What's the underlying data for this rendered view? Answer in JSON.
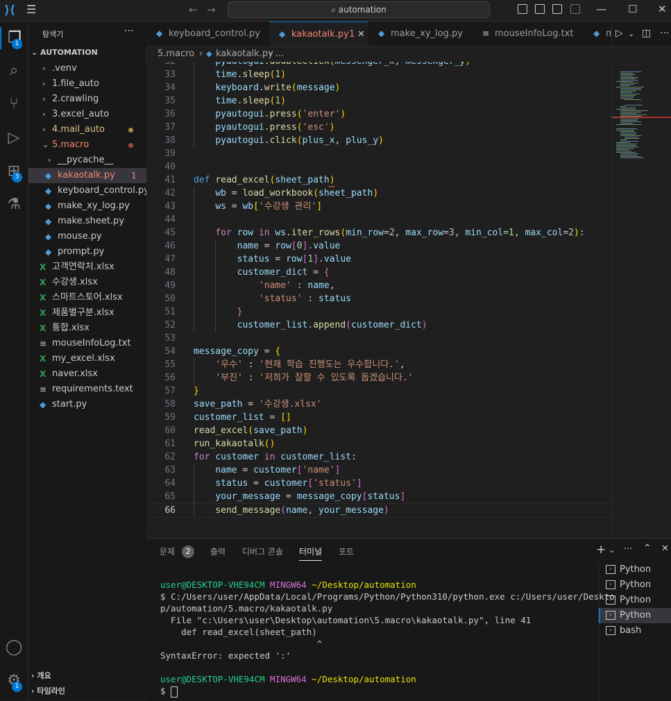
{
  "titlebar": {
    "search_text": "automation",
    "back": "←",
    "forward": "→"
  },
  "activity": {
    "explorer_badge": "1",
    "extensions_badge": "3",
    "settings_badge": "1"
  },
  "sidebar": {
    "title": "탐색기",
    "more": "···",
    "root": "AUTOMATION",
    "items": [
      {
        "label": ".venv",
        "type": "folder",
        "depth": 1,
        "open": false
      },
      {
        "label": "1.file_auto",
        "type": "folder",
        "depth": 1,
        "open": false
      },
      {
        "label": "2.crawling",
        "type": "folder",
        "depth": 1,
        "open": false
      },
      {
        "label": "3.excel_auto",
        "type": "folder",
        "depth": 1,
        "open": false
      },
      {
        "label": "4.mail_auto",
        "type": "folder",
        "depth": 1,
        "open": false,
        "modified": true
      },
      {
        "label": "5.macro",
        "type": "folder",
        "depth": 1,
        "open": true,
        "error": true
      },
      {
        "label": "__pycache__",
        "type": "folder",
        "depth": 2,
        "open": false
      },
      {
        "label": "kakaotalk.py",
        "type": "py",
        "depth": 2,
        "selected": true,
        "error_count": "1"
      },
      {
        "label": "keyboard_control.py",
        "type": "py",
        "depth": 2
      },
      {
        "label": "make_xy_log.py",
        "type": "py",
        "depth": 2
      },
      {
        "label": "make.sheet.py",
        "type": "py",
        "depth": 2
      },
      {
        "label": "mouse.py",
        "type": "py",
        "depth": 2
      },
      {
        "label": "prompt.py",
        "type": "py",
        "depth": 2
      },
      {
        "label": "고객연락처.xlsx",
        "type": "xlsx",
        "depth": 1
      },
      {
        "label": "수강생.xlsx",
        "type": "xlsx",
        "depth": 1
      },
      {
        "label": "스마트스토어.xlsx",
        "type": "xlsx",
        "depth": 1
      },
      {
        "label": "제품별구분.xlsx",
        "type": "xlsx",
        "depth": 1
      },
      {
        "label": "통합.xlsx",
        "type": "xlsx",
        "depth": 1
      },
      {
        "label": "mouseInfoLog.txt",
        "type": "txt",
        "depth": 1
      },
      {
        "label": "my_excel.xlsx",
        "type": "xlsx",
        "depth": 1
      },
      {
        "label": "naver.xlsx",
        "type": "xlsx",
        "depth": 1
      },
      {
        "label": "requirements.text",
        "type": "txt",
        "depth": 1
      },
      {
        "label": "start.py",
        "type": "py",
        "depth": 1
      }
    ],
    "outline": "개요",
    "timeline": "타임라인"
  },
  "tabs": [
    {
      "label": "keyboard_control.py",
      "icon": "python-icon"
    },
    {
      "label": "kakaotalk.py",
      "icon": "python-icon",
      "active": true,
      "suffix": "1"
    },
    {
      "label": "make_xy_log.py",
      "icon": "python-icon"
    },
    {
      "label": "mouseInfoLog.txt",
      "icon": "text-icon"
    },
    {
      "label": "m",
      "icon": "python-icon"
    }
  ],
  "breadcrumb": {
    "folder": "5.macro",
    "file": "kakaotalk.py",
    "rest": "..."
  },
  "editor": {
    "first_line": 32,
    "current_line": 66,
    "lines": [
      {
        "n": "32",
        "html": "    <span class='vr'>pyautogui</span>.<span class='fn'>doubleClick</span><span class='pn'>(</span><span class='vr'>messenger_x</span>, <span class='vr'>messenger_y</span><span class='pn'>)</span>"
      },
      {
        "n": "33",
        "html": "    <span class='vr'>time</span>.<span class='fn'>sleep</span><span class='pn'>(</span><span class='nm'>1</span><span class='pn'>)</span>"
      },
      {
        "n": "34",
        "html": "    <span class='vr'>keyboard</span>.<span class='fn'>write</span><span class='pn'>(</span><span class='vr'>message</span><span class='pn'>)</span>"
      },
      {
        "n": "35",
        "html": "    <span class='vr'>time</span>.<span class='fn'>sleep</span><span class='pn'>(</span><span class='nm'>1</span><span class='pn'>)</span>"
      },
      {
        "n": "36",
        "html": "    <span class='vr'>pyautogui</span>.<span class='fn'>press</span><span class='pn'>(</span><span class='st'>'enter'</span><span class='pn'>)</span>"
      },
      {
        "n": "37",
        "html": "    <span class='vr'>pyautogui</span>.<span class='fn'>press</span><span class='pn'>(</span><span class='st'>'esc'</span><span class='pn'>)</span>"
      },
      {
        "n": "38",
        "html": "    <span class='vr'>pyautogui</span>.<span class='fn'>click</span><span class='pn'>(</span><span class='vr'>plus_x</span>, <span class='vr'>plus_y</span><span class='pn'>)</span>"
      },
      {
        "n": "39",
        "html": ""
      },
      {
        "n": "40",
        "html": ""
      },
      {
        "n": "41",
        "html": "<span class='kw'>def</span> <span class='fn'>read_excel</span><span class='pn'>(</span><span class='vr'>sheet_path</span><span class='pn'>)</span>"
      },
      {
        "n": "42",
        "html": "    <span class='vr'>wb</span> = <span class='fn'>load_workbook</span><span class='pn'>(</span><span class='vr'>sheet_path</span><span class='pn'>)</span>"
      },
      {
        "n": "43",
        "html": "    <span class='vr'>ws</span> = <span class='vr'>wb</span><span class='pn'>[</span><span class='st'>'수강생 관리'</span><span class='pn'>]</span>"
      },
      {
        "n": "44",
        "html": ""
      },
      {
        "n": "45",
        "html": "    <span class='kw2'>for</span> <span class='vr'>row</span> <span class='kw2'>in</span> <span class='vr'>ws</span>.<span class='fn'>iter_rows</span><span class='pn'>(</span><span class='vr'>min_row</span>=<span class='nm'>2</span>, <span class='vr'>max_row</span>=<span class='nm'>3</span>, <span class='vr'>min_col</span>=<span class='nm'>1</span>, <span class='vr'>max_col</span>=<span class='nm'>2</span><span class='pn'>)</span>:"
      },
      {
        "n": "46",
        "html": "        <span class='vr'>name</span> = <span class='vr'>row</span><span class='pn2'>[</span><span class='nm'>0</span><span class='pn2'>]</span>.<span class='vr'>value</span>"
      },
      {
        "n": "47",
        "html": "        <span class='vr'>status</span> = <span class='vr'>row</span><span class='pn2'>[</span><span class='nm'>1</span><span class='pn2'>]</span>.<span class='vr'>value</span>"
      },
      {
        "n": "48",
        "html": "        <span class='vr'>customer_dict</span> = <span class='pn2'>{</span>"
      },
      {
        "n": "49",
        "html": "            <span class='st'>'name'</span> : <span class='vr'>name</span>,"
      },
      {
        "n": "50",
        "html": "            <span class='st'>'status'</span> : <span class='vr'>status</span>"
      },
      {
        "n": "51",
        "html": "        <span class='pn2'>}</span>"
      },
      {
        "n": "52",
        "html": "        <span class='vr'>customer_list</span>.<span class='fn'>append</span><span class='pn2'>(</span><span class='vr'>customer_dict</span><span class='pn2'>)</span>"
      },
      {
        "n": "53",
        "html": ""
      },
      {
        "n": "54",
        "html": "<span class='vr'>message_copy</span> = <span class='pn'>{</span>"
      },
      {
        "n": "55",
        "html": "    <span class='st'>'우수'</span> : <span class='st'>'현재 학습 진행도는 우수합니다.'</span>,"
      },
      {
        "n": "56",
        "html": "    <span class='st'>'부진'</span> : <span class='st'>'저희가 잘할 수 있도록 돕겠습니다.'</span>"
      },
      {
        "n": "57",
        "html": "<span class='pn'>}</span>"
      },
      {
        "n": "58",
        "html": "<span class='vr'>save_path</span> = <span class='st'>'수강생.xlsx'</span>"
      },
      {
        "n": "59",
        "html": "<span class='vr'>customer_list</span> = <span class='pn'>[]</span>"
      },
      {
        "n": "60",
        "html": "<span class='fn'>read_excel</span><span class='pn'>(</span><span class='vr'>save_path</span><span class='pn'>)</span>"
      },
      {
        "n": "61",
        "html": "<span class='fn'>run_kakaotalk</span><span class='pn'>()</span>"
      },
      {
        "n": "62",
        "html": "<span class='kw2'>for</span> <span class='vr'>customer</span> <span class='kw2'>in</span> <span class='vr'>customer_list</span>:"
      },
      {
        "n": "63",
        "html": "    <span class='vr'>name</span> = <span class='vr'>customer</span><span class='pn2'>[</span><span class='st'>'name'</span><span class='pn2'>]</span>"
      },
      {
        "n": "64",
        "html": "    <span class='vr'>status</span> = <span class='vr'>customer</span><span class='pn2'>[</span><span class='st'>'status'</span><span class='pn2'>]</span>"
      },
      {
        "n": "65",
        "html": "    <span class='vr'>your_message</span> = <span class='vr'>message_copy</span><span class='pn2'>[</span><span class='vr'>status</span><span class='pn2'>]</span>"
      },
      {
        "n": "66",
        "html": "    <span class='fn'>send_message</span><span class='pn2'>(</span><span class='vr'>name</span>, <span class='vr'>your_message</span><span class='pn2'>)</span>"
      }
    ]
  },
  "panel": {
    "tabs": [
      {
        "label": "문제",
        "badge": "2"
      },
      {
        "label": "출력"
      },
      {
        "label": "디버그 콘솔"
      },
      {
        "label": "터미널",
        "active": true
      },
      {
        "label": "포트"
      }
    ],
    "add": "+",
    "more": "···",
    "terminal_lines": [
      {
        "parts": [
          {
            "t": "user@DESKTOP-VHE94CM",
            "c": "t-green"
          },
          {
            "t": " "
          },
          {
            "t": "MINGW64",
            "c": "t-mag"
          },
          {
            "t": " "
          },
          {
            "t": "~/Desktop/automation",
            "c": "t-yel"
          }
        ]
      },
      {
        "parts": [
          {
            "t": "$ C:/Users/user/AppData/Local/Programs/Python/Python310/python.exe c:/Users/user/Deskto"
          }
        ]
      },
      {
        "parts": [
          {
            "t": "p/automation/5.macro/kakaotalk.py"
          }
        ]
      },
      {
        "parts": [
          {
            "t": "  File \"c:\\Users\\user\\Desktop\\automation\\5.macro\\kakaotalk.py\", line 41"
          }
        ]
      },
      {
        "parts": [
          {
            "t": "    def read_excel(sheet_path)"
          }
        ]
      },
      {
        "parts": [
          {
            "t": "                              ^"
          }
        ]
      },
      {
        "parts": [
          {
            "t": "SyntaxError: expected ':'"
          }
        ]
      },
      {
        "parts": [
          {
            "t": ""
          }
        ]
      },
      {
        "parts": [
          {
            "t": "user@DESKTOP-VHE94CM",
            "c": "t-green"
          },
          {
            "t": " "
          },
          {
            "t": "MINGW64",
            "c": "t-mag"
          },
          {
            "t": " "
          },
          {
            "t": "~/Desktop/automation",
            "c": "t-yel"
          }
        ]
      },
      {
        "parts": [
          {
            "t": "$ "
          }
        ],
        "cursor": true
      }
    ],
    "terminals": [
      {
        "label": "Python"
      },
      {
        "label": "Python"
      },
      {
        "label": "Python"
      },
      {
        "label": "Python",
        "selected": true
      },
      {
        "label": "bash"
      }
    ]
  },
  "colors": {
    "accent": "#0078d4",
    "error": "#f48771",
    "modified": "#a88a4a"
  }
}
